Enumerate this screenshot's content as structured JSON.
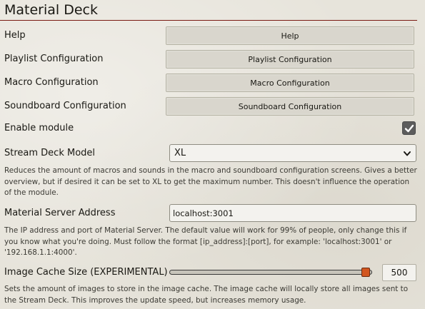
{
  "title": "Material Deck",
  "settings": {
    "help": {
      "label": "Help",
      "button_label": "Help"
    },
    "playlist": {
      "label": "Playlist Configuration",
      "button_label": "Playlist Configuration"
    },
    "macro": {
      "label": "Macro Configuration",
      "button_label": "Macro Configuration"
    },
    "soundboard": {
      "label": "Soundboard Configuration",
      "button_label": "Soundboard Configuration"
    },
    "enable_module": {
      "label": "Enable module",
      "checked": true,
      "icon": "checkmark-icon"
    },
    "stream_deck_model": {
      "label": "Stream Deck Model",
      "value": "XL",
      "icon": "chevron-down-icon",
      "hint": "Reduces the amount of macros and sounds in the macro and soundboard configuration screens. Gives a better overview, but if desired it can be set to XL to get the maximum number. This doesn't influence the operation of the module."
    },
    "server_address": {
      "label": "Material Server Address",
      "value": "localhost:3001",
      "hint": "The IP address and port of Material Server. The default value will work for 99% of people, only change this if you know what you're doing. Must follow the format [ip_address]:[port], for example: 'localhost:3001' or '192.168.1.1:4000'."
    },
    "image_cache": {
      "label": "Image Cache Size (EXPERIMENTAL)",
      "value": "500",
      "level": 0.99,
      "hint": "Sets the amount of images to store in the image cache. The image cache will locally store all images sent to the Stream Deck. This improves the update speed, but increases memory usage."
    }
  },
  "colors": {
    "title_rule": "#7a1a12",
    "slider_thumb": "#d2561f",
    "checkbox_bg": "#5c5c5c"
  }
}
